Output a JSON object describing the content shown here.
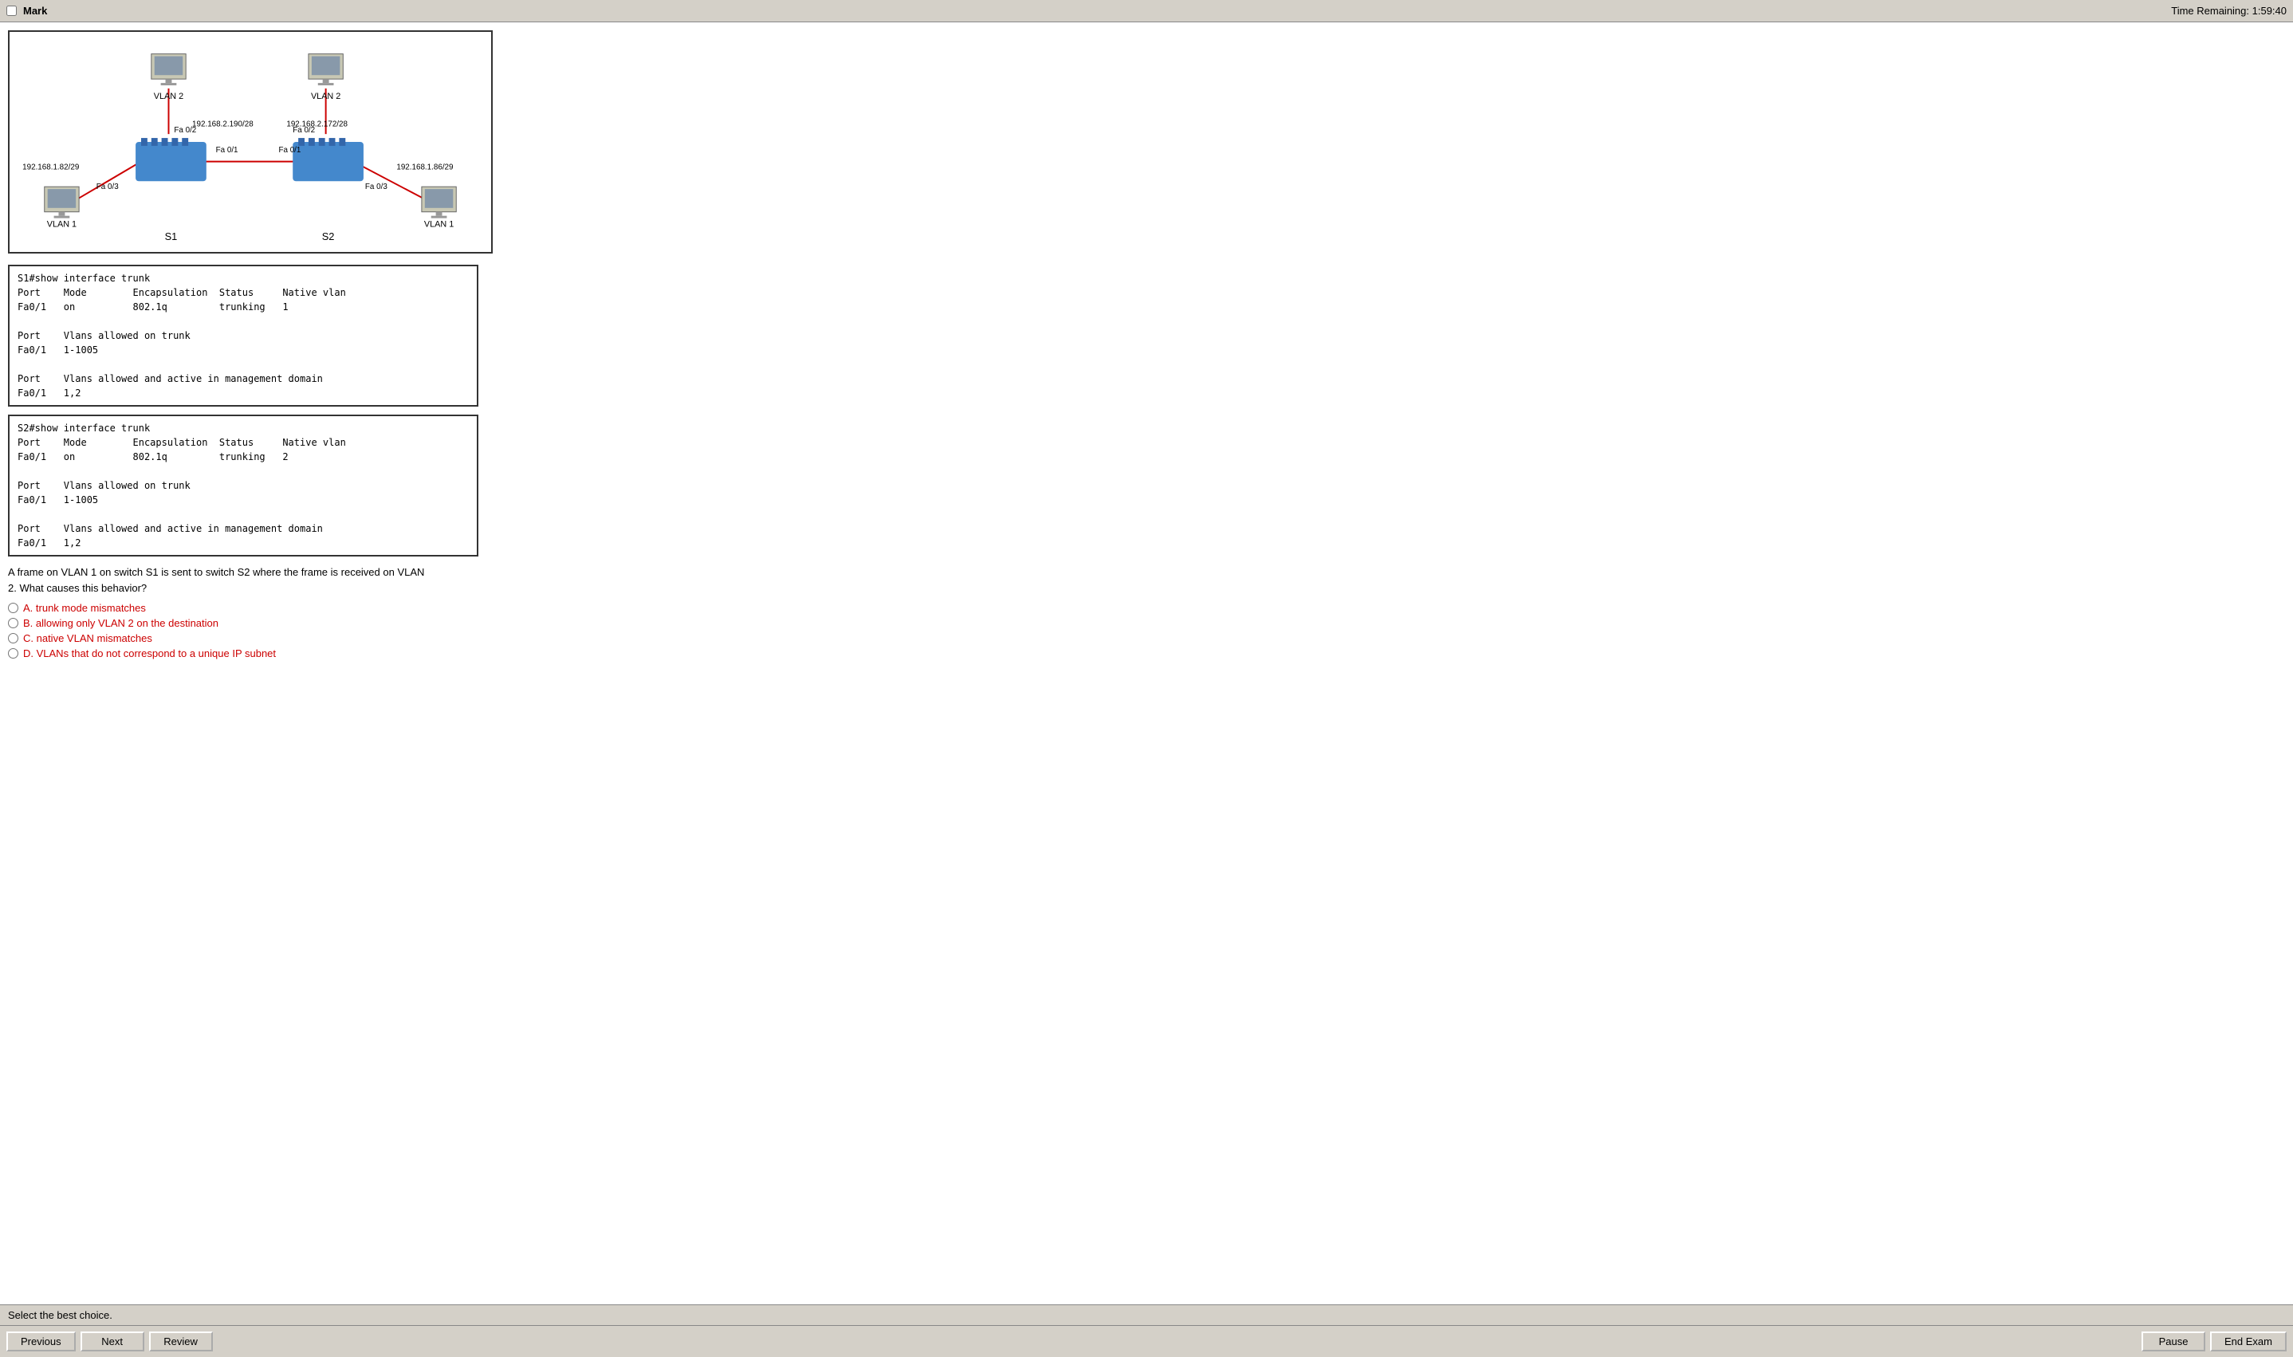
{
  "titleBar": {
    "markLabel": "Mark",
    "timeLabel": "Time Remaining: 1:59:40"
  },
  "diagram": {
    "switches": [
      {
        "id": "S1",
        "label": "S1"
      },
      {
        "id": "S2",
        "label": "S2"
      }
    ],
    "computers": [
      {
        "id": "pc1",
        "vlan": "VLAN 2",
        "ip": "192.168.2.190/28",
        "position": "top-left"
      },
      {
        "id": "pc2",
        "vlan": "VLAN 2",
        "ip": "192.168.2.172/28",
        "position": "top-right"
      },
      {
        "id": "pc3",
        "vlan": "VLAN 1",
        "ip": "192.168.1.82/29",
        "position": "left"
      },
      {
        "id": "pc4",
        "vlan": "VLAN 1",
        "ip": "192.168.1.86/29",
        "position": "right"
      }
    ],
    "interfaces": {
      "s1_to_pc1": "Fa 0/2",
      "s2_to_pc2": "Fa 0/2",
      "s1_to_pc3": "Fa 0/3",
      "s2_to_pc4": "Fa 0/3",
      "s1_to_s2_left": "Fa 0/1",
      "s1_to_s2_right": "Fa 0/1"
    }
  },
  "terminal1": {
    "command": "S1#show interface trunk",
    "header": "Port    Mode        Encapsulation  Status     Native vlan",
    "row1": "Fa0/1   on          802.1q         trunking   1",
    "blank1": "",
    "col2a": "Port    Vlans allowed on trunk",
    "col2b": "Fa0/1   1-1005",
    "blank2": "",
    "col3a": "Port    Vlans allowed and active in management domain",
    "col3b": "Fa0/1   1,2"
  },
  "terminal2": {
    "command": "S2#show interface trunk",
    "header": "Port    Mode        Encapsulation  Status     Native vlan",
    "row1": "Fa0/1   on          802.1q         trunking   2",
    "blank1": "",
    "col2a": "Port    Vlans allowed on trunk",
    "col2b": "Fa0/1   1-1005",
    "blank2": "",
    "col3a": "Port    Vlans allowed and active in management domain",
    "col3b": "Fa0/1   1,2"
  },
  "question": {
    "text": "A frame on VLAN 1 on switch S1 is sent to switch S2 where the frame is received on VLAN\n2. What causes this behavior?"
  },
  "answers": [
    {
      "id": "A",
      "label": "A.  trunk mode mismatches",
      "selected": false
    },
    {
      "id": "B",
      "label": "B.  allowing only VLAN 2 on the destination",
      "selected": false
    },
    {
      "id": "C",
      "label": "C.  native VLAN mismatches",
      "selected": false
    },
    {
      "id": "D",
      "label": "D.  VLANs that do not correspond to a unique IP subnet",
      "selected": false
    }
  ],
  "statusBar": {
    "text": "Select the best choice."
  },
  "buttons": {
    "previous": "Previous",
    "next": "Next",
    "review": "Review",
    "pause": "Pause",
    "endExam": "End Exam"
  }
}
